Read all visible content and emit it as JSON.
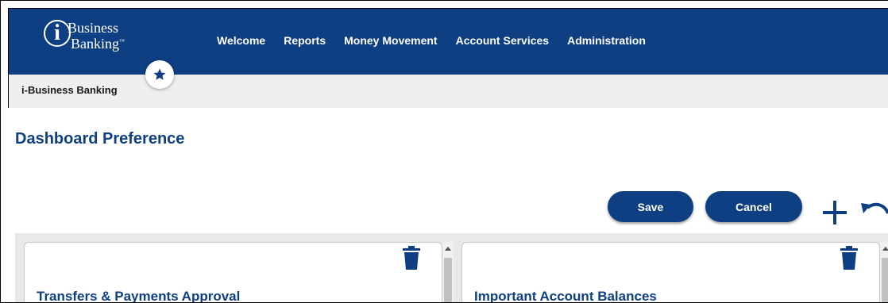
{
  "logo": {
    "letter": "i",
    "line1": "Business",
    "line2": "Banking",
    "tm": "™"
  },
  "menu": [
    "Welcome",
    "Reports",
    "Money Movement",
    "Account Services",
    "Administration"
  ],
  "breadcrumb": "i-Business Banking",
  "page_title": "Dashboard Preference",
  "buttons": {
    "save": "Save",
    "cancel": "Cancel"
  },
  "icons": [
    "star-icon",
    "plus-icon",
    "undo-icon",
    "trash-icon"
  ],
  "cards": [
    {
      "title": "Transfers & Payments Approval"
    },
    {
      "title": "Important Account Balances"
    }
  ],
  "colors": {
    "brand": "#0e3f82",
    "breadcrumb_bg": "#efefef",
    "panel_bg": "#e9e9e9"
  }
}
